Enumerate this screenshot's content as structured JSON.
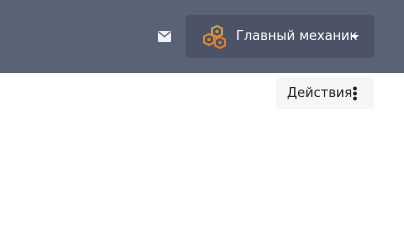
{
  "header": {
    "mail_icon": "envelope-icon",
    "user_menu": {
      "avatar_icon": "gears-logo-icon",
      "name": "Главный механик",
      "dropdown_icon": "caret-down-icon"
    }
  },
  "toolbar": {
    "actions_label": "Действия",
    "actions_icon": "vertical-dots-icon"
  },
  "colors": {
    "topbar_bg": "#5a6276",
    "user_menu_bg": "#4c5366",
    "actions_bg": "#f6f6f7",
    "gear_orange": "#d98a2b",
    "gear_gold": "#c9a04a"
  }
}
